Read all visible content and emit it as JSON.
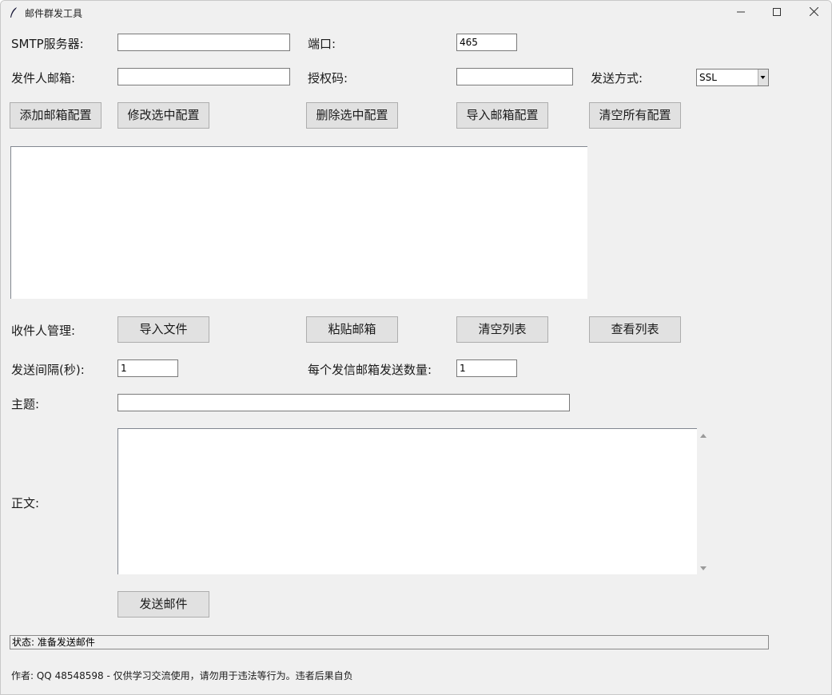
{
  "window": {
    "title": "邮件群发工具",
    "minimize_icon": "minimize-icon",
    "maximize_icon": "maximize-icon",
    "close_icon": "close-icon"
  },
  "smtp": {
    "server_label": "SMTP服务器:",
    "server_value": "",
    "port_label": "端口:",
    "port_value": "465",
    "sender_label": "发件人邮箱:",
    "sender_value": "",
    "auth_label": "授权码:",
    "auth_value": "",
    "method_label": "发送方式:",
    "method_value": "SSL"
  },
  "config_buttons": {
    "add": "添加邮箱配置",
    "edit": "修改选中配置",
    "delete": "删除选中配置",
    "import": "导入邮箱配置",
    "clear": "清空所有配置"
  },
  "recipients": {
    "label": "收件人管理:",
    "import_file": "导入文件",
    "paste": "粘贴邮箱",
    "clear": "清空列表",
    "view": "查看列表"
  },
  "send_settings": {
    "interval_label": "发送间隔(秒):",
    "interval_value": "1",
    "per_sender_label": "每个发信邮箱发送数量:",
    "per_sender_value": "1"
  },
  "message": {
    "subject_label": "主题:",
    "subject_value": "",
    "body_label": "正文:",
    "body_value": ""
  },
  "send_button": "发送邮件",
  "status_text": "状态: 准备发送邮件",
  "footer_text": "作者: QQ 48548598 - 仅供学习交流使用，请勿用于违法等行为。违者后果自负"
}
